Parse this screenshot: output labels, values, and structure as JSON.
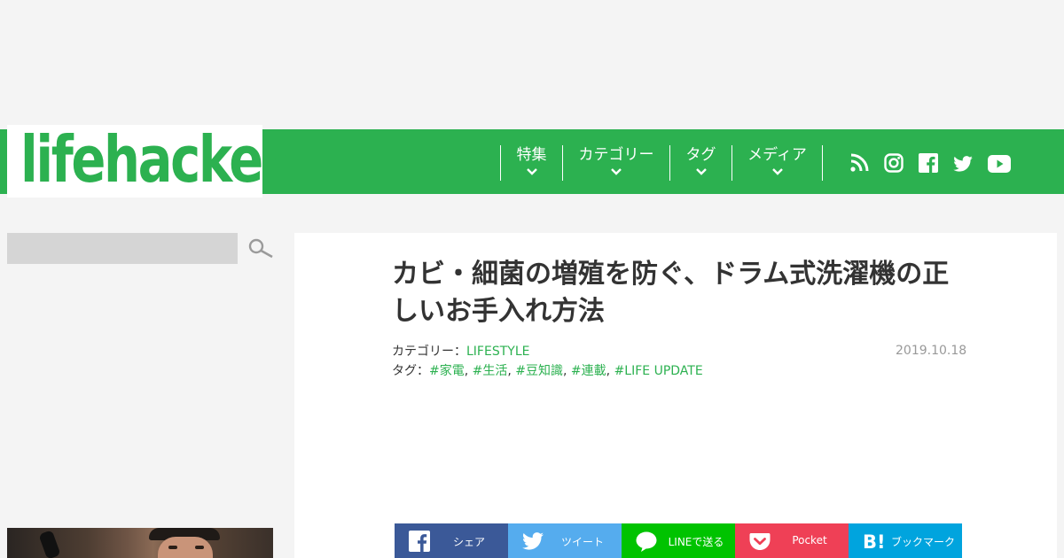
{
  "header": {
    "logo": "lifehacker",
    "nav": [
      {
        "label": "特集"
      },
      {
        "label": "カテゴリー"
      },
      {
        "label": "タグ"
      },
      {
        "label": "メディア"
      }
    ],
    "social_icons": [
      "rss-icon",
      "instagram-icon",
      "facebook-icon",
      "twitter-icon",
      "youtube-icon"
    ]
  },
  "sidebar": {
    "search_placeholder": ""
  },
  "article": {
    "title": "カビ・細菌の増殖を防ぐ、ドラム式洗濯機の正しいお手入れ方法",
    "category_label": "カテゴリー：",
    "category": "LIFESTYLE",
    "tags_label": "タグ：",
    "tags": [
      "#家電",
      "#生活",
      "#豆知識",
      "#連載",
      "#LIFE UPDATE"
    ],
    "tag_sep": ", ",
    "date": "2019.10.18"
  },
  "share": [
    {
      "label": "シェア",
      "icon": "facebook-icon",
      "color": "#3b5998"
    },
    {
      "label": "ツイート",
      "icon": "twitter-icon",
      "color": "#55acee"
    },
    {
      "label": "LINEで送る",
      "icon": "line-icon",
      "color": "#00c300"
    },
    {
      "label": "Pocket",
      "icon": "pocket-icon",
      "color": "#ef4056"
    },
    {
      "label": "ブックマーク",
      "icon": "hatena-bookmark-icon",
      "color": "#00a4de"
    }
  ],
  "colors": {
    "brand_green": "#2cb150",
    "page_bg": "#f4f4f4"
  }
}
